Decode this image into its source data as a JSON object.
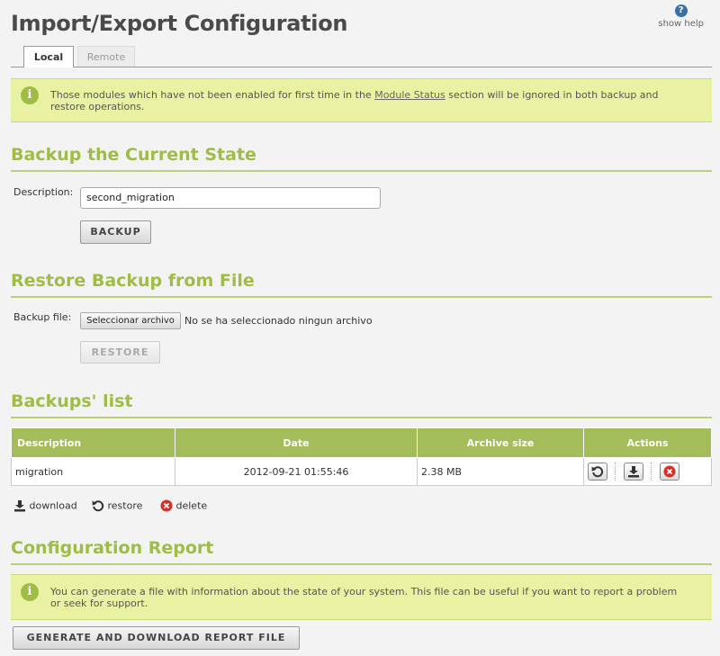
{
  "page": {
    "title": "Import/Export Configuration",
    "help_label": "show help",
    "help_icon": "?"
  },
  "tabs": [
    {
      "label": "Local",
      "active": true
    },
    {
      "label": "Remote",
      "active": false
    }
  ],
  "notice1": {
    "text_before": "Those modules which have not been enabled for first time in the ",
    "link": "Module Status",
    "text_after": " section will be ignored in both backup and restore operations."
  },
  "backup": {
    "heading": "Backup the Current State",
    "description_label": "Description:",
    "description_value": "second_migration",
    "button": "BACKUP"
  },
  "restore": {
    "heading": "Restore Backup from File",
    "file_label": "Backup file:",
    "file_button": "Seleccionar archivo",
    "file_status": "No se ha seleccionado ningun archivo",
    "button": "RESTORE"
  },
  "list": {
    "heading": "Backups' list",
    "columns": [
      "Description",
      "Date",
      "Archive size",
      "Actions"
    ],
    "rows": [
      {
        "description": "migration",
        "date": "2012-09-21 01:55:46",
        "size": "2.38 MB"
      }
    ]
  },
  "legend": {
    "download": "download",
    "restore": "restore",
    "delete": "delete"
  },
  "report": {
    "heading": "Configuration Report",
    "notice": "You can generate a file with information about the state of your system. This file can be useful if you want to report a problem or seek for support.",
    "button": "GENERATE AND DOWNLOAD REPORT FILE"
  },
  "colors": {
    "accent": "#9fbd45",
    "notice_bg": "#e9f2a3",
    "table_header": "#a3bd5a",
    "delete": "#d93025"
  }
}
